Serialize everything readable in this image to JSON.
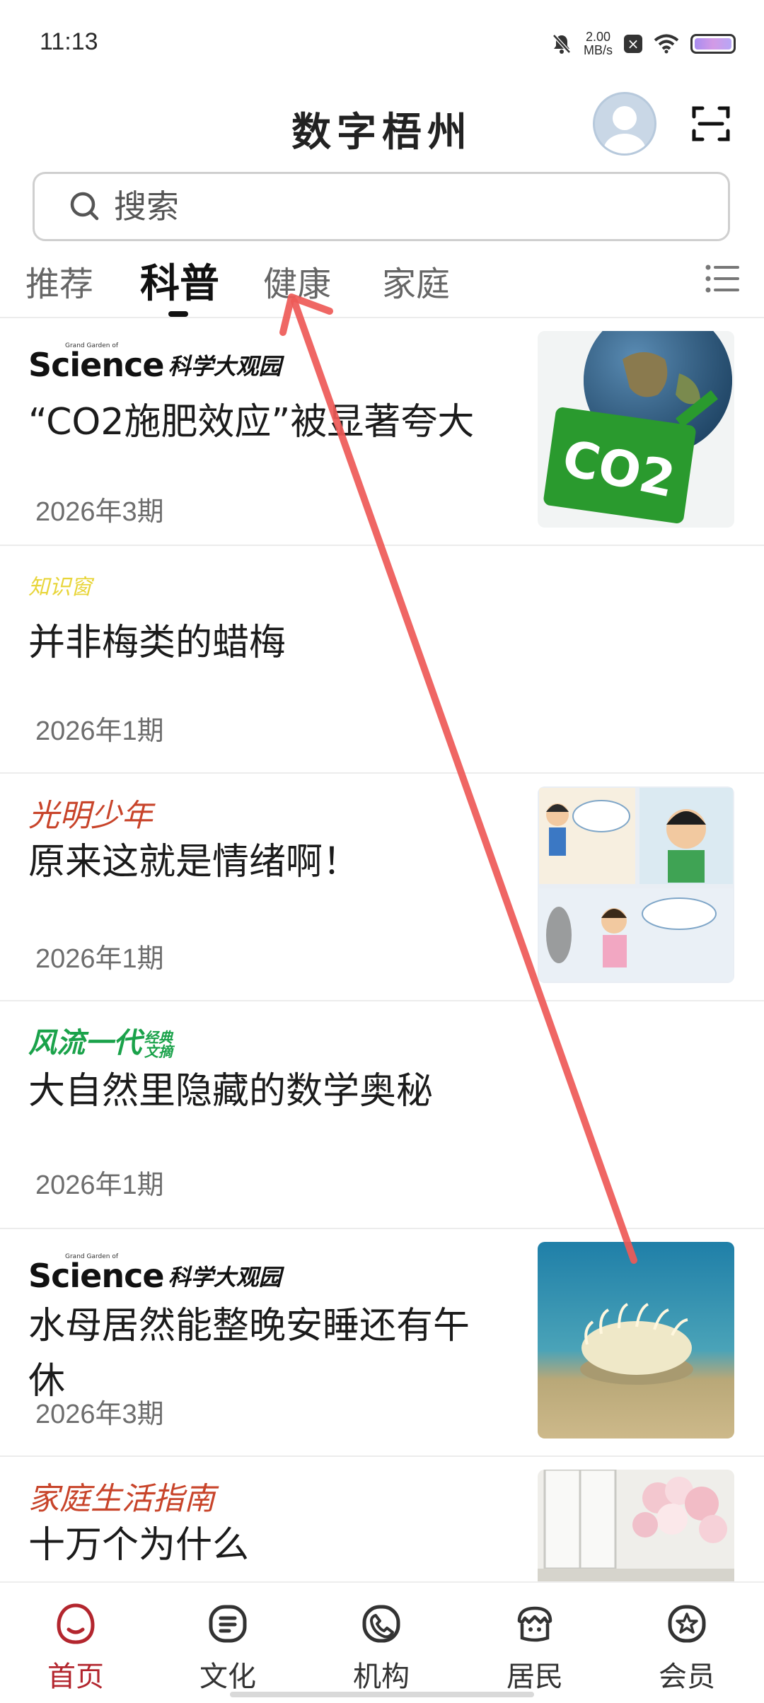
{
  "status_bar": {
    "time": "11:13",
    "net_speed_value": "2.00",
    "net_speed_unit": "MB/s",
    "icons": [
      "mute-icon",
      "speed-indicator",
      "close-notification-icon",
      "wifi-icon",
      "battery-icon"
    ]
  },
  "header": {
    "title": "数字梧州"
  },
  "search": {
    "placeholder": "搜索"
  },
  "tabs": [
    {
      "label": "推荐",
      "active": false
    },
    {
      "label": "科普",
      "active": true
    },
    {
      "label": "健康",
      "active": false
    },
    {
      "label": "家庭",
      "active": false
    }
  ],
  "feed": [
    {
      "source": {
        "type": "science",
        "brand": "Science",
        "brand_cn": "科学大观园",
        "small": "Grand Garden of"
      },
      "title": "“CO2施肥效应”被显著夸大",
      "date": "2026年3期",
      "thumb": "co2-globe",
      "thumb_text": "CO2"
    },
    {
      "source": {
        "type": "zhishi",
        "brand": "知识窗"
      },
      "title": "并非梅类的蜡梅",
      "date": "2026年1期",
      "thumb": null
    },
    {
      "source": {
        "type": "italic-red",
        "brand": "光明少年"
      },
      "title": "原来这就是情绪啊！",
      "date": "2026年1期",
      "thumb": "comic-kids"
    },
    {
      "source": {
        "type": "green",
        "brand": "风流一代",
        "brand_sub": "经典文摘"
      },
      "title": "大自然里隐藏的数学奥秘",
      "date": "2026年1期",
      "thumb": null
    },
    {
      "source": {
        "type": "science",
        "brand": "Science",
        "brand_cn": "科学大观园",
        "small": "Grand Garden of"
      },
      "title": "水母居然能整晚安睡还有午休",
      "date": "2026年3期",
      "thumb": "jellyfish"
    },
    {
      "source": {
        "type": "italic-red",
        "brand": "家庭生活指南"
      },
      "title": "十万个为什么",
      "date": "",
      "thumb": "flowers-window"
    }
  ],
  "bottom_nav": [
    {
      "label": "首页",
      "icon": "home-icon",
      "active": true
    },
    {
      "label": "文化",
      "icon": "document-icon",
      "active": false
    },
    {
      "label": "机构",
      "icon": "phone-icon",
      "active": false
    },
    {
      "label": "居民",
      "icon": "residents-icon",
      "active": false
    },
    {
      "label": "会员",
      "icon": "member-star-icon",
      "active": false
    }
  ],
  "colors": {
    "accent_red": "#b3262e",
    "gesture_arrow": "#ee5a57",
    "divider": "#ececec"
  }
}
